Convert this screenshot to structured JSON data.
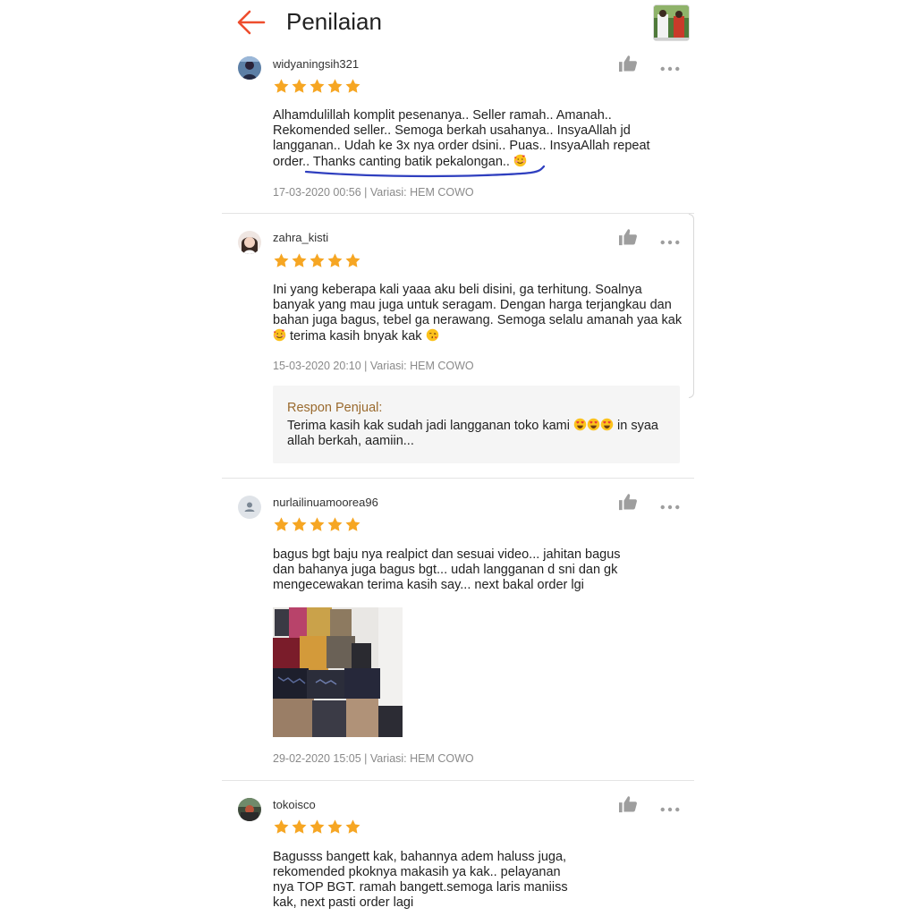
{
  "header": {
    "title": "Penilaian",
    "back_icon": "arrow-left-icon",
    "accent_color": "#ee4d2d"
  },
  "reviews": [
    {
      "username": "widyaningsih321",
      "rating": 5,
      "text_lines": [
        "Alhamdulillah komplit pesenanya..  Seller ramah..  Amanah..",
        "Rekomended seller..  Semoga berkah usahanya..  InsyaAllah jd",
        "langganan..  Udah ke 3x nya order dsini..  Puas..  InsyaAllah repeat",
        "order..  Thanks canting batik pekalongan.."
      ],
      "meta": "17-03-2020 00:56 | Variasi: HEM COWO"
    },
    {
      "username": "zahra_kisti",
      "rating": 5,
      "text_lines": [
        "Ini yang keberapa kali yaaa aku beli disini, ga terhitung. Soalnya",
        "banyak yang mau juga untuk seragam. Dengan harga terjangkau dan",
        "bahan juga bagus, tebel ga nerawang. Semoga selalu amanah yaa kak",
        "terima kasih bnyak kak"
      ],
      "meta": "15-03-2020 20:10 | Variasi: HEM COWO",
      "seller_response": {
        "label": "Respon Penjual:",
        "line1_a": "Terima kasih kak sudah jadi langganan toko kami",
        "line1_b": "in syaa",
        "line2": "allah berkah, aamiin..."
      }
    },
    {
      "username": "nurlailinuamoorea96",
      "rating": 5,
      "text_lines": [
        "bagus bgt baju nya realpict dan sesuai video... jahitan bagus",
        "dan bahanya juga bagus bgt... udah langganan d sni dan gk",
        "mengecewakan terima kasih say... next bakal order lgi"
      ],
      "meta": "29-02-2020 15:05 | Variasi: HEM COWO"
    },
    {
      "username": "tokoisco",
      "rating": 5,
      "text_lines": [
        "Bagusss bangett kak, bahannya adem haluss juga,",
        "rekomended pkoknya makasih ya kak.. pelayanan",
        "nya TOP BGT. ramah bangett.semoga laris maniiss",
        "kak, next pasti order lagi"
      ]
    }
  ],
  "icons": {
    "like": "thumbs-up-icon",
    "more": "more-dots-icon",
    "star": "star-icon",
    "default_avatar": "person-icon"
  },
  "colors": {
    "star": "#f6a623",
    "icon_gray": "#9e9e9e",
    "seller_label": "#9a6a2e",
    "annotation_underline": "#2f3fbf"
  }
}
